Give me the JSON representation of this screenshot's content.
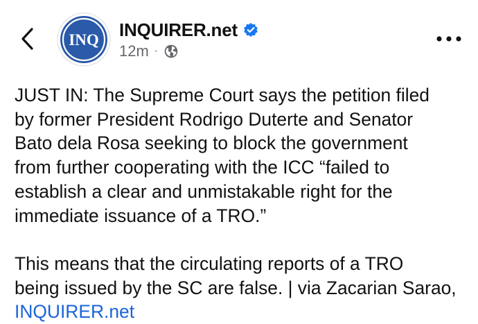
{
  "header": {
    "page_name": "INQUIRER.net",
    "avatar_text": "INQ",
    "timestamp": "12m",
    "separator": "·",
    "back_icon": "chevron-left-icon",
    "verified_icon": "verified-badge-icon",
    "privacy_icon": "globe-icon",
    "more_icon": "more-horizontal-icon",
    "brand_color": "#2a5aa8",
    "verified_color": "#1877f2"
  },
  "post": {
    "paragraph1_lines": [
      "JUST IN: The Supreme Court says the petition filed",
      "by former President Rodrigo Duterte and Senator",
      "Bato dela Rosa seeking to block the government",
      "from further cooperating with the ICC “failed to",
      "establish a clear and unmistakable right for the",
      "immediate issuance of a TRO.”"
    ],
    "paragraph2_lines": [
      "This means that the circulating reports of a TRO",
      "being issued by the SC are false. | via Zacarian Sarao,"
    ],
    "link_text": "INQUIRER.net",
    "link_color": "#1b64d8"
  }
}
